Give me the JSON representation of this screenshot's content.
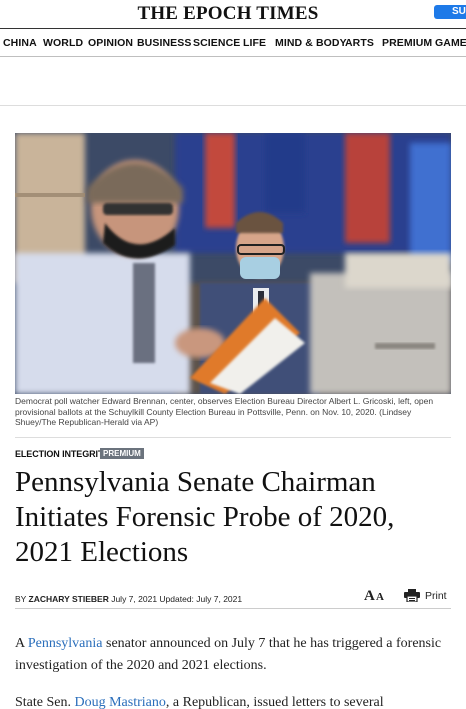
{
  "masthead": {
    "logo": "THE EPOCH TIMES",
    "subscribe_label": "SUBSCRIBE"
  },
  "nav": {
    "items": [
      "CHINA",
      "WORLD",
      "OPINION",
      "BUSINESS",
      "SCIENCE",
      "LIFE",
      "MIND & BODY",
      "ARTS",
      "PREMIUM",
      "GAMES"
    ]
  },
  "photo": {
    "caption": "Democrat poll watcher Edward Brennan, center, observes Election Bureau Director Albert L. Gricoski, left, open provisional ballots at the Schuylkill County Election Bureau in Pottsville, Penn. on Nov. 10, 2020. (Lindsey Shuey/The Republican-Herald via AP)"
  },
  "article": {
    "section": "ELECTION INTEGRITY",
    "badge": "PREMIUM",
    "headline": "Pennsylvania Senate Chairman Initiates Forensic Probe of 2020, 2021 Elections",
    "byline_prefix": "BY ",
    "author": "ZACHARY STIEBER",
    "published": " July 7, 2021 ",
    "updated": "Updated: July 7, 2021",
    "font_size_big": "A",
    "font_size_small": "A",
    "print_label": "Print",
    "p1_pre": "A ",
    "p1_link": "Pennsylvania",
    "p1_post": " senator announced on July 7 that he has triggered a forensic investigation of the 2020 and 2021 elections.",
    "p2_pre": "State Sen. ",
    "p2_link": "Doug Mastriano",
    "p2_post": ", a Republican, issued letters to several"
  },
  "colors": {
    "accent": "#1e7ae8",
    "link": "#2a6ebb",
    "badge": "#6b737d"
  }
}
